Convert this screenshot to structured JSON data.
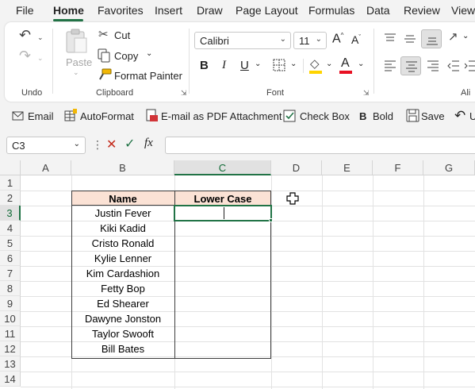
{
  "menu": {
    "tabs": [
      "File",
      "Home",
      "Favorites",
      "Insert",
      "Draw",
      "Page Layout",
      "Formulas",
      "Data",
      "Review",
      "View"
    ],
    "active": "Home"
  },
  "ribbon": {
    "undo_group": "Undo",
    "clipboard": {
      "paste": "Paste",
      "cut": "Cut",
      "copy": "Copy",
      "format_painter": "Format Painter",
      "label": "Clipboard"
    },
    "font": {
      "name": "Calibri",
      "size": "11",
      "grow": "A",
      "shrink": "A",
      "bold": "B",
      "italic": "I",
      "underline": "U",
      "font_color_letter": "A",
      "label": "Font"
    },
    "alignment_label_partial": "Ali"
  },
  "quickbar": {
    "email": "Email",
    "autoformat": "AutoFormat",
    "email_pdf": "E-mail as PDF Attachment",
    "checkbox": "Check Box",
    "bold": "Bold",
    "bold_glyph": "B",
    "save": "Save",
    "undo_partial": "U"
  },
  "formula_bar": {
    "name_box": "C3",
    "fx": "fx",
    "value": ""
  },
  "grid": {
    "columns": [
      "A",
      "B",
      "C",
      "D",
      "E",
      "F",
      "G"
    ],
    "rows": [
      "1",
      "2",
      "3",
      "4",
      "5",
      "6",
      "7",
      "8",
      "9",
      "10",
      "11",
      "12",
      "13",
      "14"
    ],
    "selected_col": "C",
    "selected_row": "3"
  },
  "table": {
    "header_name": "Name",
    "header_lower": "Lower Case",
    "names": [
      "Justin Fever",
      "Kiki Kadid",
      "Cristo Ronald",
      "Kylie Lenner",
      "Kim Cardashion",
      "Fetty Bop",
      "Ed Shearer",
      "Dawyne Jonston",
      "Taylor Swooft",
      "Bill Bates"
    ]
  },
  "colors": {
    "accent_green": "#217346",
    "header_fill": "#fbe2d5",
    "font_color_bar": "#e81123",
    "fill_color_bar": "#ffd400"
  }
}
